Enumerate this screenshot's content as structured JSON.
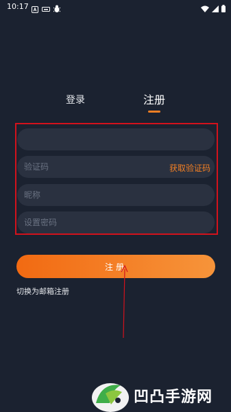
{
  "status_bar": {
    "time": "10:17",
    "icons_left": [
      "a-icon",
      "cast-icon",
      "bug-icon"
    ],
    "icons_right": [
      "wifi-icon",
      "signal-icon",
      "battery-icon"
    ]
  },
  "tabs": {
    "login": "登录",
    "register": "注册",
    "active": "register"
  },
  "form": {
    "phone_placeholder": "",
    "code_placeholder": "验证码",
    "get_code_label": "获取验证码",
    "nickname_placeholder": "昵称",
    "password_placeholder": "设置密码"
  },
  "submit_label": "注册",
  "switch_link": "切换为邮箱注册",
  "watermark": {
    "text": "凹凸手游网"
  },
  "colors": {
    "background": "#1b2230",
    "accent": "#f27f24",
    "annotation_red": "#d4121c",
    "field_bg": "#2a3140"
  }
}
